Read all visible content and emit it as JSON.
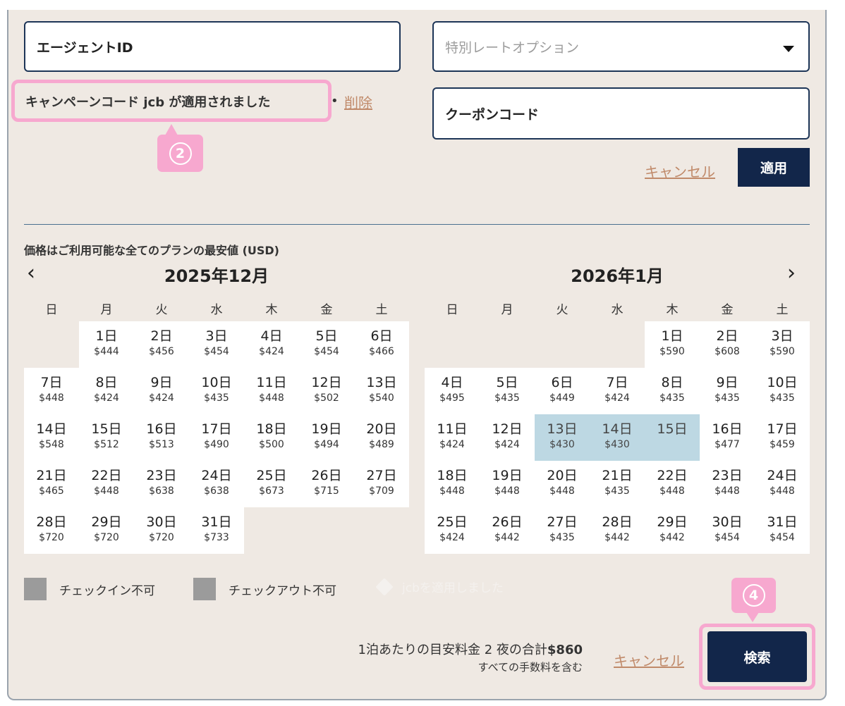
{
  "form": {
    "agent_id_value": "エージェントID",
    "special_rate_placeholder": "特別レートオプション",
    "coupon_value": "クーポンコード",
    "campaign_applied_text": "キャンペーンコード jcb が適用されました",
    "campaign_separator": "•",
    "remove_label": "削除",
    "cancel_label": "キャンセル",
    "apply_label": "適用"
  },
  "annotations": {
    "step2": "2",
    "step4": "4",
    "highlight_color": "#f7a8cf"
  },
  "calendar": {
    "price_note": "価格はご利用可能な全てのプランの最安値 (USD)",
    "prev_label": "‹",
    "next_label": "›",
    "weekdays": [
      "日",
      "月",
      "火",
      "水",
      "木",
      "金",
      "土"
    ],
    "months": [
      {
        "title": "2025年12月",
        "first_weekday": 1,
        "days": [
          {
            "d": "1日",
            "p": "$444"
          },
          {
            "d": "2日",
            "p": "$456"
          },
          {
            "d": "3日",
            "p": "$454"
          },
          {
            "d": "4日",
            "p": "$424"
          },
          {
            "d": "5日",
            "p": "$454"
          },
          {
            "d": "6日",
            "p": "$466"
          },
          {
            "d": "7日",
            "p": "$448"
          },
          {
            "d": "8日",
            "p": "$424"
          },
          {
            "d": "9日",
            "p": "$424"
          },
          {
            "d": "10日",
            "p": "$435"
          },
          {
            "d": "11日",
            "p": "$448"
          },
          {
            "d": "12日",
            "p": "$502"
          },
          {
            "d": "13日",
            "p": "$540"
          },
          {
            "d": "14日",
            "p": "$548"
          },
          {
            "d": "15日",
            "p": "$512"
          },
          {
            "d": "16日",
            "p": "$513"
          },
          {
            "d": "17日",
            "p": "$490"
          },
          {
            "d": "18日",
            "p": "$500"
          },
          {
            "d": "19日",
            "p": "$494"
          },
          {
            "d": "20日",
            "p": "$489"
          },
          {
            "d": "21日",
            "p": "$465"
          },
          {
            "d": "22日",
            "p": "$448"
          },
          {
            "d": "23日",
            "p": "$638"
          },
          {
            "d": "24日",
            "p": "$638"
          },
          {
            "d": "25日",
            "p": "$673"
          },
          {
            "d": "26日",
            "p": "$715"
          },
          {
            "d": "27日",
            "p": "$709"
          },
          {
            "d": "28日",
            "p": "$720"
          },
          {
            "d": "29日",
            "p": "$720"
          },
          {
            "d": "30日",
            "p": "$720"
          },
          {
            "d": "31日",
            "p": "$733"
          }
        ]
      },
      {
        "title": "2026年1月",
        "first_weekday": 4,
        "days": [
          {
            "d": "1日",
            "p": "$590"
          },
          {
            "d": "2日",
            "p": "$608"
          },
          {
            "d": "3日",
            "p": "$590"
          },
          {
            "d": "4日",
            "p": "$495"
          },
          {
            "d": "5日",
            "p": "$435"
          },
          {
            "d": "6日",
            "p": "$449"
          },
          {
            "d": "7日",
            "p": "$424"
          },
          {
            "d": "8日",
            "p": "$435"
          },
          {
            "d": "9日",
            "p": "$435"
          },
          {
            "d": "10日",
            "p": "$435"
          },
          {
            "d": "11日",
            "p": "$424"
          },
          {
            "d": "12日",
            "p": "$424"
          },
          {
            "d": "13日",
            "p": "$430",
            "sel": true
          },
          {
            "d": "14日",
            "p": "$430",
            "sel": true
          },
          {
            "d": "15日",
            "p": "",
            "sel": true
          },
          {
            "d": "16日",
            "p": "$477"
          },
          {
            "d": "17日",
            "p": "$459"
          },
          {
            "d": "18日",
            "p": "$448"
          },
          {
            "d": "19日",
            "p": "$448"
          },
          {
            "d": "20日",
            "p": "$448"
          },
          {
            "d": "21日",
            "p": "$435"
          },
          {
            "d": "22日",
            "p": "$448"
          },
          {
            "d": "23日",
            "p": "$448"
          },
          {
            "d": "24日",
            "p": "$448"
          },
          {
            "d": "25日",
            "p": "$424"
          },
          {
            "d": "26日",
            "p": "$442"
          },
          {
            "d": "27日",
            "p": "$435"
          },
          {
            "d": "28日",
            "p": "$442"
          },
          {
            "d": "29日",
            "p": "$442"
          },
          {
            "d": "30日",
            "p": "$454"
          },
          {
            "d": "31日",
            "p": "$454"
          }
        ]
      }
    ],
    "selected_color": "#bdd8e3"
  },
  "legend": {
    "no_checkin": "チェックイン不可",
    "no_checkout": "チェックアウト不可",
    "applied": "jcbを適用しました"
  },
  "footer": {
    "total_prefix": "1泊あたりの目安料金 2 夜の合計",
    "total_amount": "$860",
    "fees_note": "すべての手数料を含む",
    "cancel_label": "キャンセル",
    "search_label": "検索"
  }
}
